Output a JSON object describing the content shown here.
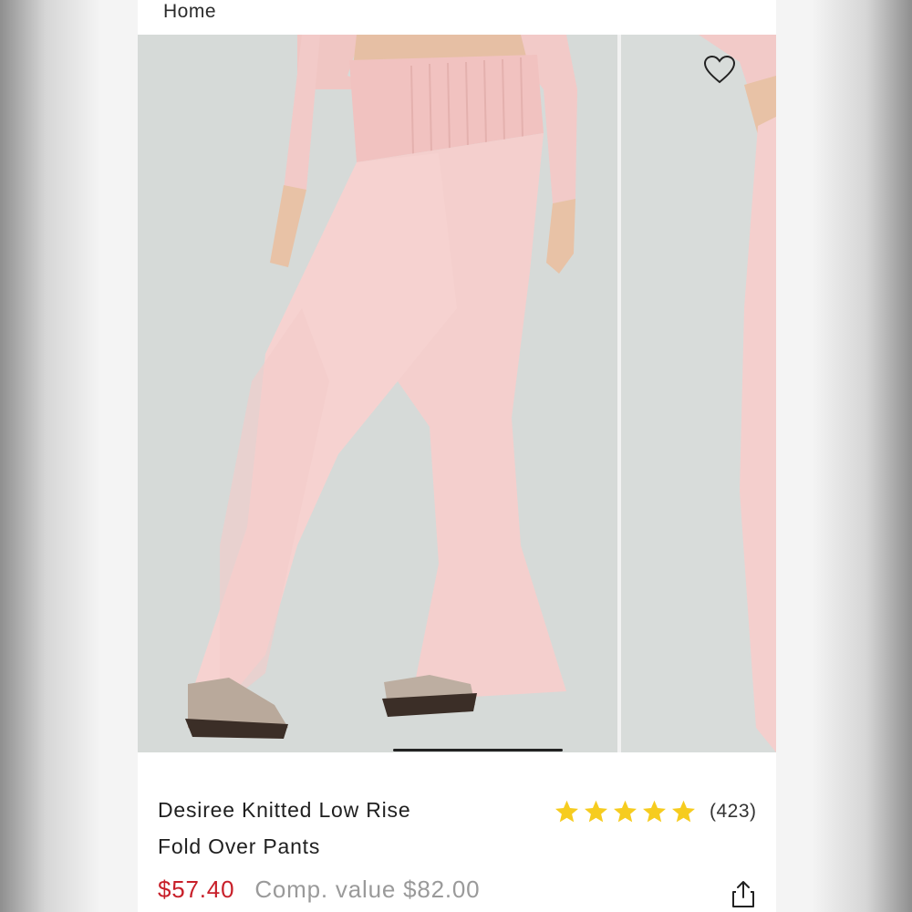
{
  "nav": {
    "home_label": "Home"
  },
  "gallery": {
    "colors": {
      "background": "#d7dbd9",
      "garment": "#f3cccb",
      "shoe_dark": "#3b2e27",
      "shoe_tan": "#b7a99c"
    },
    "favorite_icon": "heart-outline-icon",
    "slide_count_visible": 2
  },
  "product": {
    "title_line1": "Desiree Knitted Low Rise",
    "title_line2": "Fold Over Pants",
    "rating": 5,
    "review_count": "(423)",
    "price": "$57.40",
    "comp_value": "Comp. value $82.00",
    "share_icon": "share-icon"
  },
  "colors": {
    "price": "#c8202a",
    "star": "#f6cc1f",
    "muted": "#9a9a9a"
  }
}
